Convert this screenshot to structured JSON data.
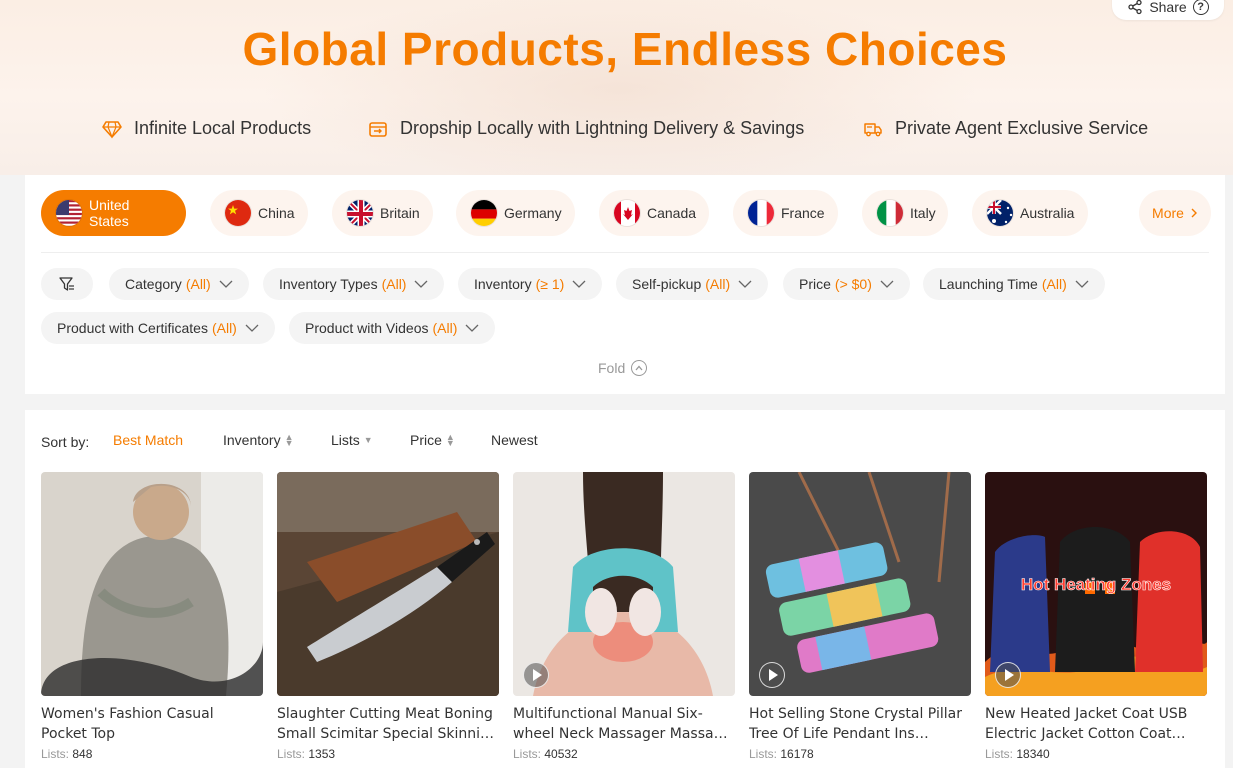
{
  "hero": {
    "title": "Global Products, Endless Choices",
    "share_label": "Share",
    "features": [
      {
        "icon": "diamond-icon",
        "label": "Infinite Local Products"
      },
      {
        "icon": "delivery-box-icon",
        "label": "Dropship Locally with Lightning Delivery & Savings"
      },
      {
        "icon": "truck-icon",
        "label": "Private Agent Exclusive Service"
      }
    ]
  },
  "countries": {
    "items": [
      {
        "label": "United States",
        "flag": "us-flag-icon",
        "active": true
      },
      {
        "label": "China",
        "flag": "china-flag-icon",
        "active": false
      },
      {
        "label": "Britain",
        "flag": "uk-flag-icon",
        "active": false
      },
      {
        "label": "Germany",
        "flag": "germany-flag-icon",
        "active": false
      },
      {
        "label": "Canada",
        "flag": "canada-flag-icon",
        "active": false
      },
      {
        "label": "France",
        "flag": "france-flag-icon",
        "active": false
      },
      {
        "label": "Italy",
        "flag": "italy-flag-icon",
        "active": false
      },
      {
        "label": "Australia",
        "flag": "australia-flag-icon",
        "active": false
      }
    ],
    "more_label": "More"
  },
  "filters": {
    "items": [
      {
        "label": "Category",
        "value": "(All)"
      },
      {
        "label": "Inventory Types",
        "value": "(All)"
      },
      {
        "label": "Inventory",
        "value": "(≥ 1)"
      },
      {
        "label": "Self-pickup",
        "value": "(All)"
      },
      {
        "label": "Price",
        "value": "(> $0)"
      },
      {
        "label": "Launching Time",
        "value": "(All)"
      },
      {
        "label": "Product with Certificates",
        "value": "(All)"
      },
      {
        "label": "Product with Videos",
        "value": "(All)"
      }
    ],
    "fold_label": "Fold"
  },
  "sort": {
    "label": "Sort by:",
    "options": [
      "Best Match",
      "Inventory",
      "Lists",
      "Price",
      "Newest"
    ],
    "active": "Best Match"
  },
  "products": [
    {
      "title": "Women's Fashion Casual Pocket Top",
      "lists_label": "Lists:",
      "lists": "848",
      "has_video": false
    },
    {
      "title": "Slaughter Cutting Meat Boning Small Scimitar Special Skinning Knife",
      "lists_label": "Lists:",
      "lists": "1353",
      "has_video": false
    },
    {
      "title": "Multifunctional Manual Six-wheel Neck Massager Massage Reliever",
      "lists_label": "Lists:",
      "lists": "40532",
      "has_video": true
    },
    {
      "title": "Hot Selling Stone Crystal Pillar Tree Of Life Pendant Ins Fashion Necklace",
      "lists_label": "Lists:",
      "lists": "16178",
      "has_video": true
    },
    {
      "title": "New Heated Jacket Coat USB Electric Jacket Cotton Coat Heater",
      "lists_label": "Lists:",
      "lists": "18340",
      "has_video": true,
      "overlay_text": "Hot Heating Zones"
    }
  ],
  "colors": {
    "accent": "#f57c00",
    "pill_bg": "#f4f4f4",
    "country_bg": "#fdf4ee"
  }
}
